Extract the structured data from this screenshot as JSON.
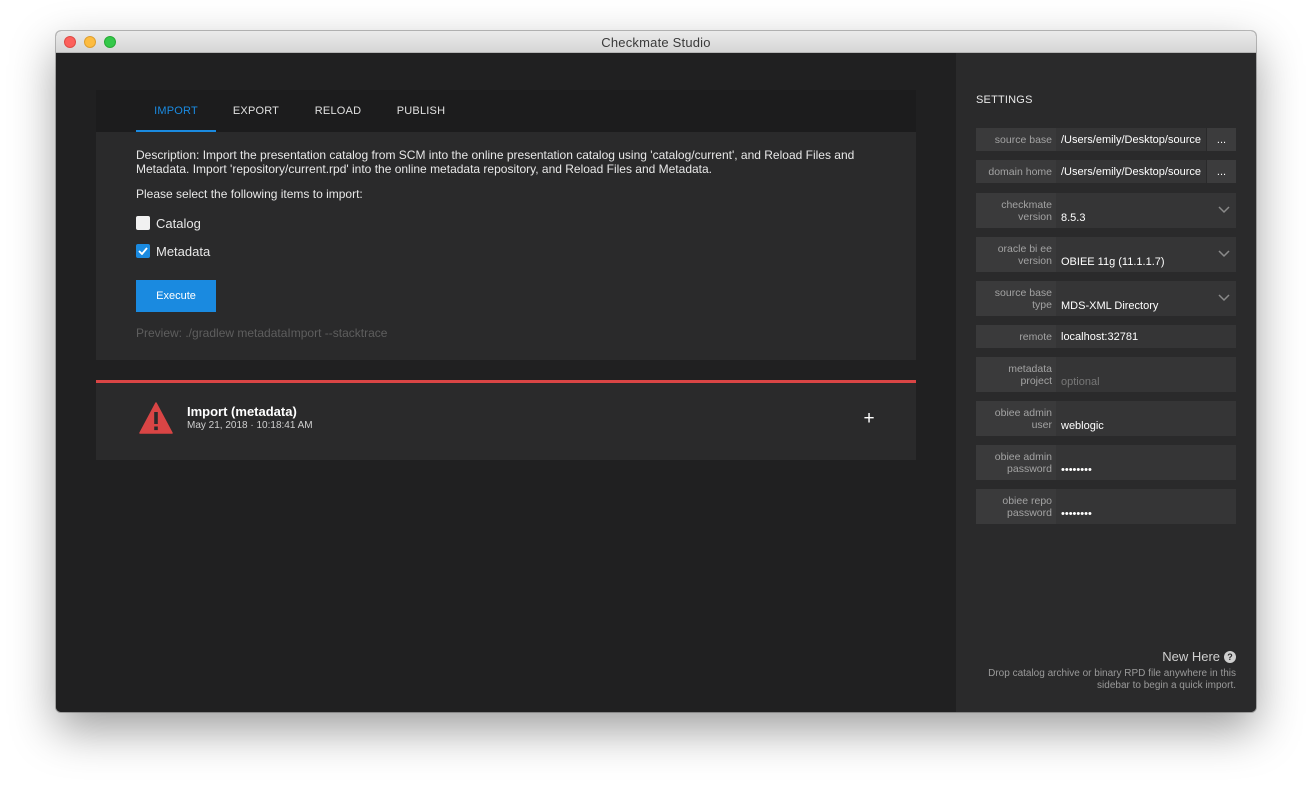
{
  "window": {
    "title": "Checkmate Studio"
  },
  "tabs": [
    {
      "label": "IMPORT",
      "active": true
    },
    {
      "label": "EXPORT",
      "active": false
    },
    {
      "label": "RELOAD",
      "active": false
    },
    {
      "label": "PUBLISH",
      "active": false
    }
  ],
  "import": {
    "description": "Description: Import the presentation catalog from SCM into the online presentation catalog using 'catalog/current', and Reload Files and Metadata. Import 'repository/current.rpd' into the online metadata repository, and Reload Files and Metadata.",
    "select_label": "Please select the following items to import:",
    "items": [
      {
        "label": "Catalog",
        "checked": false
      },
      {
        "label": "Metadata",
        "checked": true
      }
    ],
    "execute_label": "Execute",
    "preview": "Preview: ./gradlew metadataImport --stacktrace"
  },
  "notification": {
    "title": "Import (metadata)",
    "time": "May 21, 2018 · 10:18:41 AM",
    "status": "error",
    "icon": "warning-icon",
    "expand_label": "+"
  },
  "settings": {
    "title": "SETTINGS",
    "fields": [
      {
        "label": "source base",
        "value": "/Users/emily/Desktop/source",
        "browse": "..."
      },
      {
        "label": "domain home",
        "value": "/Users/emily/Desktop/source",
        "browse": "..."
      },
      {
        "label": "checkmate version",
        "value": "8.5.3",
        "dropdown": true
      },
      {
        "label": "oracle bi ee version",
        "value": "OBIEE 11g (11.1.1.7)",
        "dropdown": true
      },
      {
        "label": "source base type",
        "value": "MDS-XML Directory",
        "dropdown": true
      },
      {
        "label": "remote",
        "value": "localhost:32781"
      },
      {
        "label": "metadata project",
        "placeholder": "optional"
      },
      {
        "label": "obiee admin user",
        "value": "weblogic"
      },
      {
        "label": "obiee admin password",
        "value": "••••••••"
      },
      {
        "label": "obiee repo password",
        "value": "••••••••"
      }
    ],
    "help": {
      "title": "New Here",
      "text": "Drop catalog archive or binary RPD file anywhere in this sidebar to begin a quick import."
    }
  },
  "colors": {
    "accent": "#1a8ae0",
    "error": "#d94545",
    "background": "#202021",
    "panel": "#2a2a2b"
  }
}
